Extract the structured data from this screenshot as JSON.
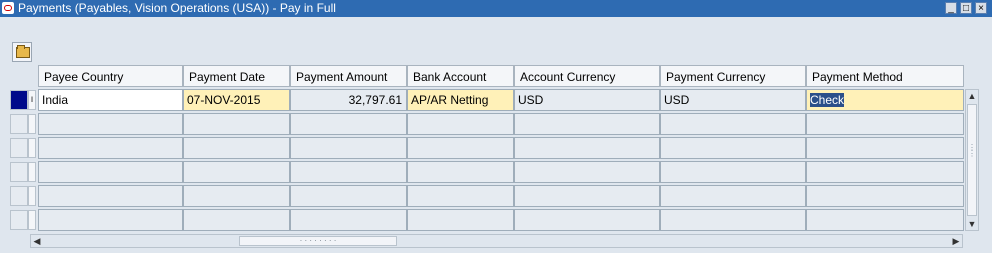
{
  "window": {
    "title": "Payments (Payables, Vision Operations (USA)) - Pay in Full",
    "controls": [
      "minimize",
      "maximize",
      "close"
    ]
  },
  "toolbar": {
    "open_folder_icon": "folder-open-icon"
  },
  "table": {
    "columns": [
      {
        "label": "Payee Country"
      },
      {
        "label": "Payment Date"
      },
      {
        "label": "Payment Amount"
      },
      {
        "label": "Bank Account"
      },
      {
        "label": "Account Currency"
      },
      {
        "label": "Payment Currency"
      },
      {
        "label": "Payment Method"
      }
    ],
    "rows": [
      {
        "payee_country": "India",
        "payment_date": "07-NOV-2015",
        "payment_amount": "32,797.61",
        "bank_account": "AP/AR Netting",
        "account_currency": "USD",
        "payment_currency": "USD",
        "payment_method": "Check"
      },
      {
        "payee_country": "",
        "payment_date": "",
        "payment_amount": "",
        "bank_account": "",
        "account_currency": "",
        "payment_currency": "",
        "payment_method": ""
      },
      {
        "payee_country": "",
        "payment_date": "",
        "payment_amount": "",
        "bank_account": "",
        "account_currency": "",
        "payment_currency": "",
        "payment_method": ""
      },
      {
        "payee_country": "",
        "payment_date": "",
        "payment_amount": "",
        "bank_account": "",
        "account_currency": "",
        "payment_currency": "",
        "payment_method": ""
      },
      {
        "payee_country": "",
        "payment_date": "",
        "payment_amount": "",
        "bank_account": "",
        "account_currency": "",
        "payment_currency": "",
        "payment_method": ""
      },
      {
        "payee_country": "",
        "payment_date": "",
        "payment_amount": "",
        "bank_account": "",
        "account_currency": "",
        "payment_currency": "",
        "payment_method": ""
      }
    ]
  },
  "colors": {
    "titlebar": "#2e6bb2",
    "required_field": "#fff1b8",
    "current_record": "#000a8a",
    "selection": "#2b4f8a"
  }
}
